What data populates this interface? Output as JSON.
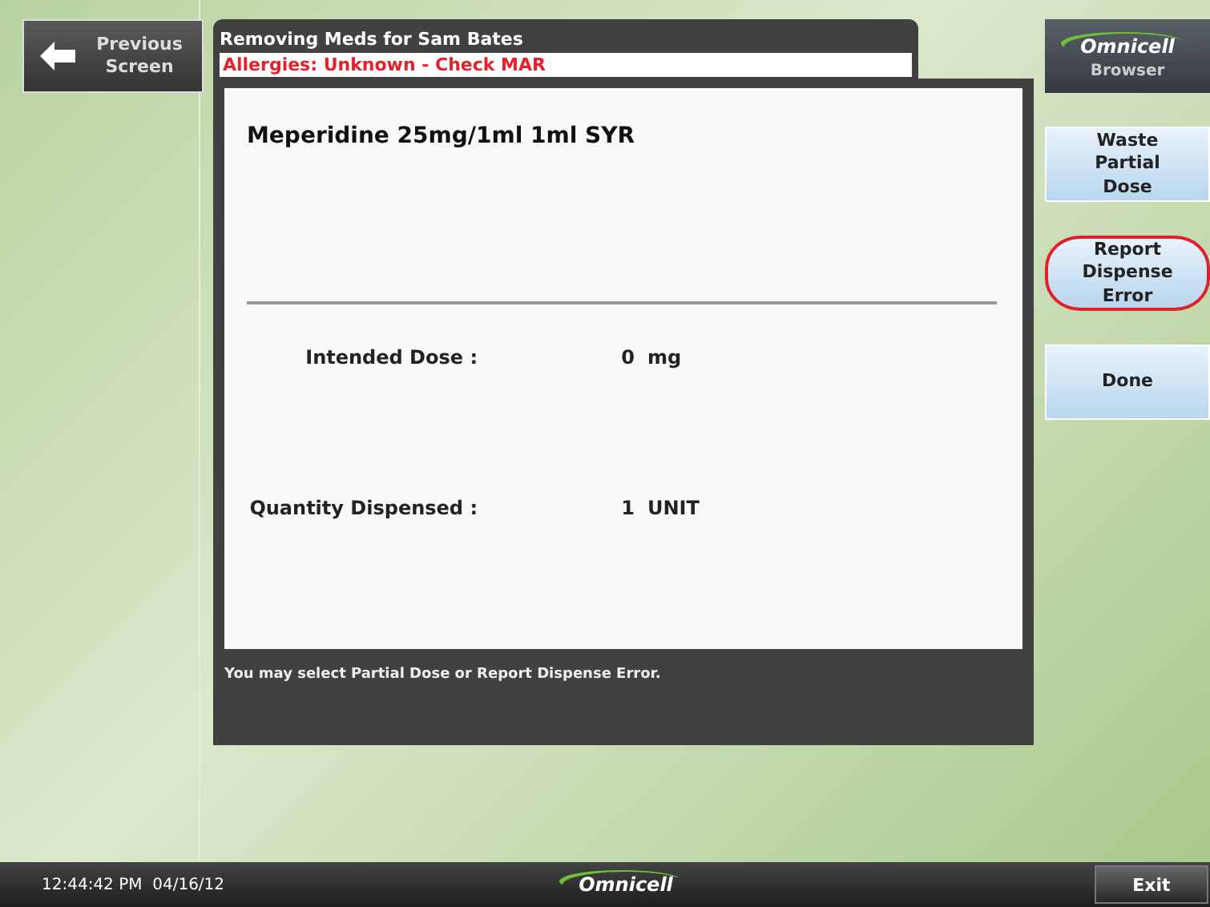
{
  "back_button": {
    "label": "Previous Screen"
  },
  "header": {
    "title": "Removing Meds for Sam Bates",
    "allergies": "Allergies: Unknown - Check MAR"
  },
  "medication": {
    "name": "Meperidine 25mg/1ml 1ml SYR"
  },
  "fields": [
    {
      "label": "Intended Dose :",
      "value": "0",
      "unit": "mg"
    },
    {
      "label": "Quantity Dispensed :",
      "value": "1",
      "unit": "UNIT"
    }
  ],
  "message": "You may select Partial Dose or Report Dispense Error.",
  "brand_panel": {
    "logo": "Omnicell",
    "subtitle": "Browser"
  },
  "actions": [
    {
      "label": "Waste Partial Dose",
      "circled": false
    },
    {
      "label": "Report Dispense Error",
      "circled": true
    },
    {
      "label": "Done",
      "circled": false
    }
  ],
  "status_bar": {
    "time": "12:44:42 PM",
    "date": "04/16/12",
    "logo": "Omnicell",
    "exit": "Exit"
  }
}
